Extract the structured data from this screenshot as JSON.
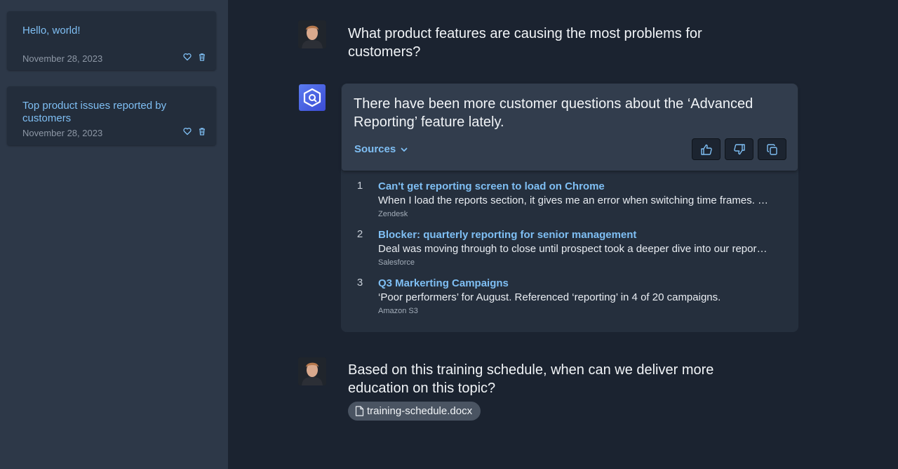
{
  "sidebar": {
    "conversations": [
      {
        "title": "Hello, world!",
        "date": "November 28, 2023"
      },
      {
        "title": "Top product issues reported by customers",
        "date": "November 28, 2023"
      }
    ]
  },
  "chat": {
    "question1": "What product features are causing the most problems for customers?",
    "answer": "There have been more customer questions about the ‘Advanced Reporting’ feature lately.",
    "sources_label": "Sources",
    "sources": [
      {
        "num": "1",
        "title": "Can't get reporting screen to load on Chrome",
        "snippet": "When I load the reports section, it gives me an error when switching time frames. …",
        "origin": "Zendesk"
      },
      {
        "num": "2",
        "title": "Blocker: quarterly reporting for senior management",
        "snippet": "Deal was moving through to close until prospect took a deeper dive into our repor…",
        "origin": "Salesforce"
      },
      {
        "num": "3",
        "title": "Q3 Markerting Campaigns",
        "snippet": "‘Poor performers’ for August. Referenced ‘reporting’ in 4 of 20 campaigns.",
        "origin": "Amazon S3"
      }
    ],
    "question2": "Based on this training schedule, when can we deliver more education on this topic?",
    "attachment": "training-schedule.docx"
  },
  "icons": {
    "favorite": "heart-icon",
    "delete": "trash-icon",
    "thumbs_up": "thumbs-up-icon",
    "thumbs_down": "thumbs-down-icon",
    "copy": "copy-icon",
    "file": "file-icon",
    "chevron": "chevron-down-icon"
  },
  "colors": {
    "background": "#1b2330",
    "sidebar": "#2d3848",
    "accent_link": "#7fbff4",
    "bot_avatar": "#4a63e0"
  }
}
